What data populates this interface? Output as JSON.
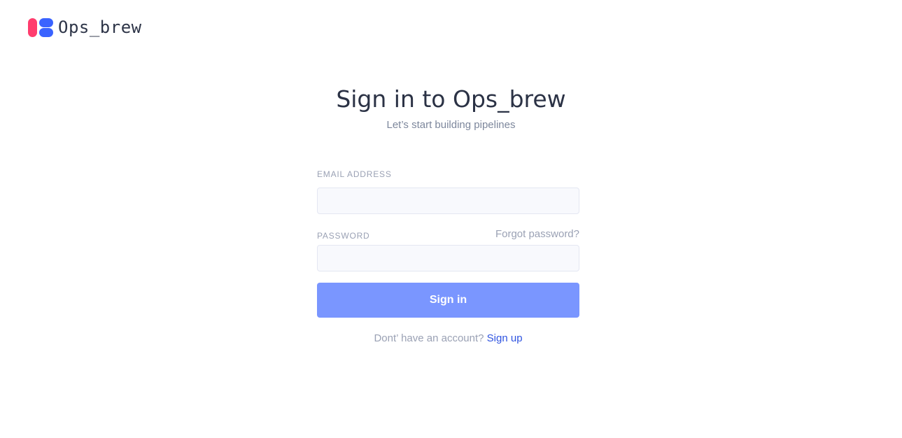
{
  "brand": {
    "name": "Ops_brew",
    "logo_icon": "ops-brew-logo-icon",
    "colors": {
      "logo_red": "#ff3d6e",
      "logo_blue": "#3a63ff"
    }
  },
  "header": {
    "title": "Sign in to Ops_brew",
    "subtitle": "Let’s start building pipelines"
  },
  "form": {
    "email": {
      "label": "EMAIL ADDRESS",
      "value": "",
      "placeholder": ""
    },
    "password": {
      "label": "PASSWORD",
      "value": "",
      "placeholder": "",
      "forgot_label": "Forgot password?"
    },
    "submit_label": "Sign in",
    "submit_color": "#7a96ff"
  },
  "footer": {
    "prompt": "Dont’ have an account?",
    "signup_label": "Sign up",
    "link_color": "#2f54e0"
  }
}
